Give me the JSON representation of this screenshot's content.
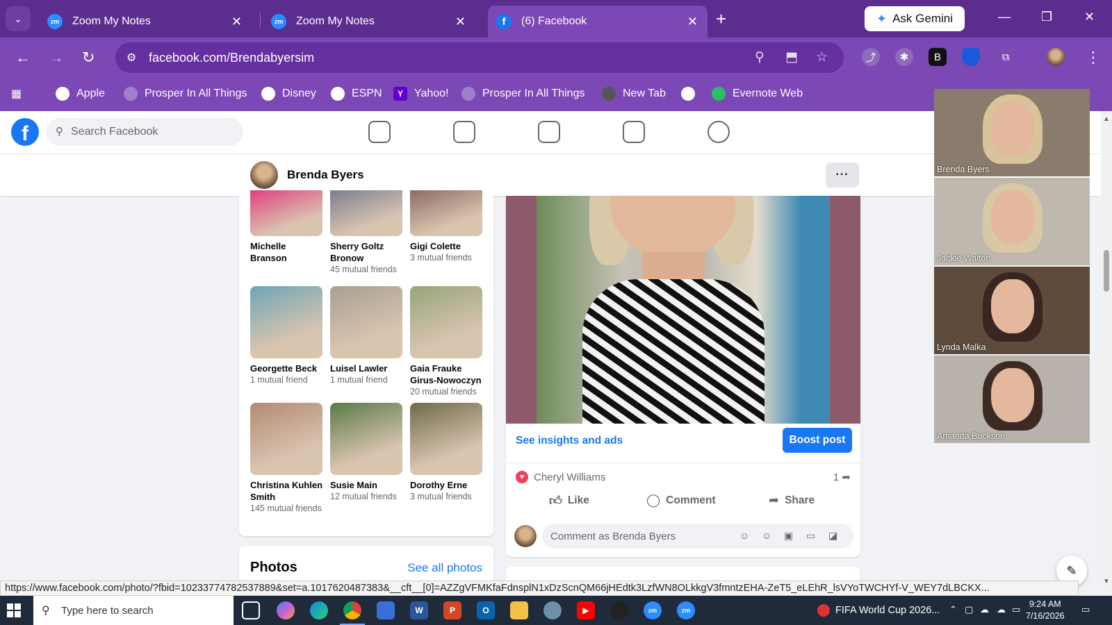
{
  "browser": {
    "tabs": [
      {
        "label": "Zoom My Notes",
        "favicon": "zm"
      },
      {
        "label": "Zoom My Notes",
        "favicon": "zm"
      },
      {
        "label": "(6) Facebook",
        "favicon": "f"
      }
    ],
    "gemini_label": "Ask Gemini",
    "url": "facebook.com/Brendabyersim",
    "extension_b_label": "B",
    "bookmarks": [
      "Apple",
      "Prosper In All Things",
      "Disney",
      "ESPN",
      "Yahoo!",
      "Prosper In All Things",
      "New Tab",
      "",
      "Evernote Web"
    ],
    "yahoo_glyph": "Y"
  },
  "facebook": {
    "logo_glyph": "f",
    "search_placeholder": "Search Facebook",
    "profile_name": "Brenda Byers",
    "more_label": "···",
    "friends": [
      {
        "name": "Michelle Branson",
        "mutual": "",
        "color": "#e0407f"
      },
      {
        "name": "Sherry Goltz Bronow",
        "mutual": "45 mutual friends",
        "color": "#7c7f90"
      },
      {
        "name": "Gigi Colette",
        "mutual": "3 mutual friends",
        "color": "#8a6d62"
      },
      {
        "name": "Georgette Beck",
        "mutual": "1 mutual friend",
        "color": "#6fa6b5"
      },
      {
        "name": "Luisel Lawler",
        "mutual": "1 mutual friend",
        "color": "#a8a091"
      },
      {
        "name": "Gaia Frauke Girus-Nowoczyn",
        "mutual": "20 mutual friends",
        "color": "#96a57b"
      },
      {
        "name": "Christina Kuhlen Smith",
        "mutual": "145 mutual friends",
        "color": "#b48a72"
      },
      {
        "name": "Susie Main",
        "mutual": "12 mutual friends",
        "color": "#5b7a47"
      },
      {
        "name": "Dorothy Erne",
        "mutual": "3 mutual friends",
        "color": "#6f6b4a"
      }
    ],
    "photos_title": "Photos",
    "photos_link": "See all photos",
    "post": {
      "insights_label": "See insights and ads",
      "boost_label": "Boost post",
      "reactor_name": "Cheryl Williams",
      "share_count": "1",
      "like_label": "Like",
      "comment_label": "Comment",
      "share_label": "Share",
      "comment_placeholder": "Comment as Brenda Byers"
    }
  },
  "zoom": {
    "participants": [
      {
        "name": "Brenda Byers",
        "bg": "#8b7b6c",
        "hair": "#d9c39a"
      },
      {
        "name": "Jackie Walton",
        "bg": "#bfb8ae",
        "hair": "#d8c8a6"
      },
      {
        "name": "Lynda Malka",
        "bg": "#5e4b3c",
        "hair": "#3a2620"
      },
      {
        "name": "Amanda Buckson",
        "bg": "#b9b2aa",
        "hair": "#3d2a22"
      }
    ]
  },
  "status_url": "https://www.facebook.com/photo/?fbid=10233774782537889&set=a.1017620487383&__cft__[0]=AZZgVFMKfaFdnsplN1xDzScnQM66jHEdtk3LzfWN8OLkkgV3fmntzEHA-ZeT5_eLEhR_lsVYoTWCHYf-V_WEY7dLBCKX...",
  "taskbar": {
    "search_placeholder": "Type here to search",
    "news_label": "FIFA World Cup 2026...",
    "time": "9:24 AM",
    "date": "7/16/2026",
    "zoom_glyph": "zm",
    "word_glyph": "W",
    "powerpoint_glyph": "P",
    "outlook_glyph": "O"
  },
  "colors": {
    "chrome_frame": "#5b2d8e",
    "chrome_toolbar": "#7b48b5",
    "facebook_blue": "#1877f2",
    "taskbar": "#1f2b3a"
  }
}
